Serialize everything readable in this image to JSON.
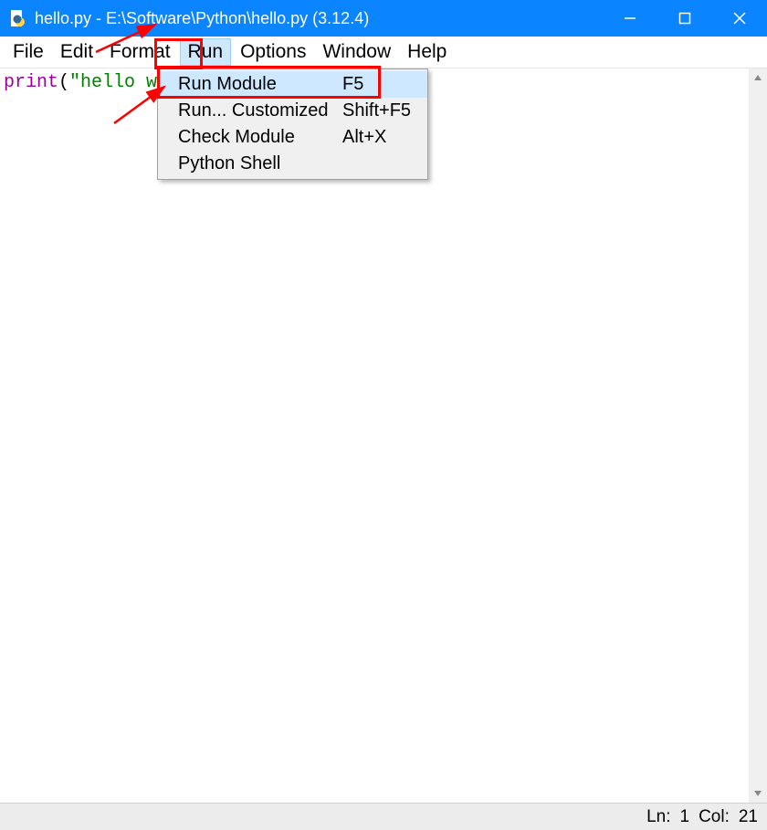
{
  "title": "hello.py - E:\\Software\\Python\\hello.py (3.12.4)",
  "menus": {
    "file": "File",
    "edit": "Edit",
    "format": "Format",
    "run": "Run",
    "options": "Options",
    "window": "Window",
    "help": "Help"
  },
  "code": {
    "func": "print",
    "lparen": "(",
    "strquote": "\"",
    "strtext": "hello wor",
    "full_line_hint": "print(\"hello world\")"
  },
  "dropdown": {
    "items": [
      {
        "label": "Run Module",
        "shortcut": "F5"
      },
      {
        "label": "Run... Customized",
        "shortcut": "Shift+F5"
      },
      {
        "label": "Check Module",
        "shortcut": "Alt+X"
      },
      {
        "label": "Python Shell",
        "shortcut": ""
      }
    ]
  },
  "status": {
    "ln_label": "Ln:",
    "ln_value": "1",
    "col_label": "Col:",
    "col_value": "21"
  }
}
